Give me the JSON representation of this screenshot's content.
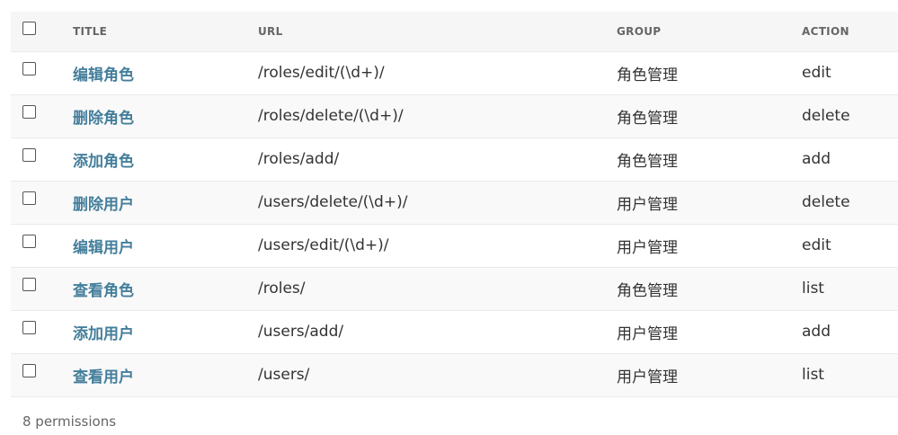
{
  "table": {
    "columns": [
      "TITLE",
      "URL",
      "GROUP",
      "ACTION"
    ],
    "rows": [
      {
        "title": "编辑角色",
        "url": "/roles/edit/(\\d+)/",
        "group": "角色管理",
        "action": "edit"
      },
      {
        "title": "删除角色",
        "url": "/roles/delete/(\\d+)/",
        "group": "角色管理",
        "action": "delete"
      },
      {
        "title": "添加角色",
        "url": "/roles/add/",
        "group": "角色管理",
        "action": "add"
      },
      {
        "title": "删除用户",
        "url": "/users/delete/(\\d+)/",
        "group": "用户管理",
        "action": "delete"
      },
      {
        "title": "编辑用户",
        "url": "/users/edit/(\\d+)/",
        "group": "用户管理",
        "action": "edit"
      },
      {
        "title": "查看角色",
        "url": "/roles/",
        "group": "角色管理",
        "action": "list"
      },
      {
        "title": "添加用户",
        "url": "/users/add/",
        "group": "用户管理",
        "action": "add"
      },
      {
        "title": "查看用户",
        "url": "/users/",
        "group": "用户管理",
        "action": "list"
      }
    ]
  },
  "footer": {
    "count_label": "8 permissions"
  },
  "colors": {
    "link": "#447e9b",
    "header_bg": "#f6f6f6",
    "row_alt_bg": "#f9f9f9",
    "border": "#eaeaea"
  }
}
